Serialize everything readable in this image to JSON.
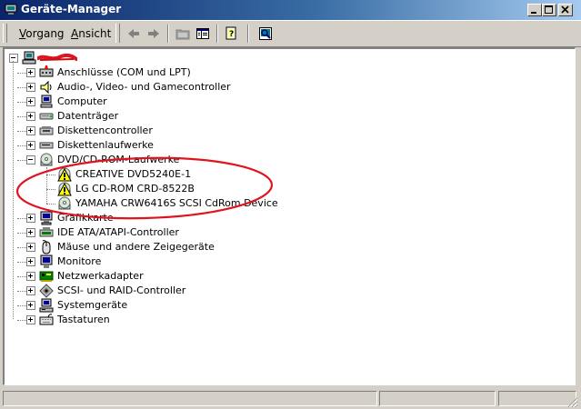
{
  "window": {
    "title": "Geräte-Manager"
  },
  "menu": {
    "vorgang_prefix": "V",
    "vorgang_rest": "organg",
    "ansicht_prefix": "A",
    "ansicht_rest": "nsicht"
  },
  "tree": {
    "root_label": "",
    "categories": [
      {
        "label": "Anschlüsse (COM und LPT)",
        "icon": "port-icon"
      },
      {
        "label": "Audio-, Video- und Gamecontroller",
        "icon": "speaker-icon"
      },
      {
        "label": "Computer",
        "icon": "computer-icon"
      },
      {
        "label": "Datenträger",
        "icon": "disk-drive-icon"
      },
      {
        "label": "Diskettencontroller",
        "icon": "floppy-controller-icon"
      },
      {
        "label": "Diskettenlaufwerke",
        "icon": "floppy-drive-icon"
      },
      {
        "label": "DVD/CD-ROM-Laufwerke",
        "icon": "cdrom-icon"
      },
      {
        "label": "Grafikkarte",
        "icon": "display-adapter-icon"
      },
      {
        "label": "IDE ATA/ATAPI-Controller",
        "icon": "ide-controller-icon"
      },
      {
        "label": "Mäuse und andere Zeigegeräte",
        "icon": "mouse-icon"
      },
      {
        "label": "Monitore",
        "icon": "monitor-icon"
      },
      {
        "label": "Netzwerkadapter",
        "icon": "network-adapter-icon"
      },
      {
        "label": "SCSI- und RAID-Controller",
        "icon": "scsi-controller-icon"
      },
      {
        "label": "Systemgeräte",
        "icon": "system-devices-icon"
      },
      {
        "label": "Tastaturen",
        "icon": "keyboard-icon"
      }
    ],
    "dvd_devices": [
      {
        "label": "CREATIVE DVD5240E-1",
        "icon": "cdrom-warning-icon"
      },
      {
        "label": "LG CD-ROM CRD-8522B",
        "icon": "cdrom-warning-icon"
      },
      {
        "label": "YAMAHA CRW6416S SCSI CdRom Device",
        "icon": "cdrom-icon"
      }
    ]
  },
  "colors": {
    "title_gradient_start": "#0a246a",
    "title_gradient_end": "#a6caf0",
    "annotation_red": "#e0141e",
    "face": "#d4d0c8"
  }
}
